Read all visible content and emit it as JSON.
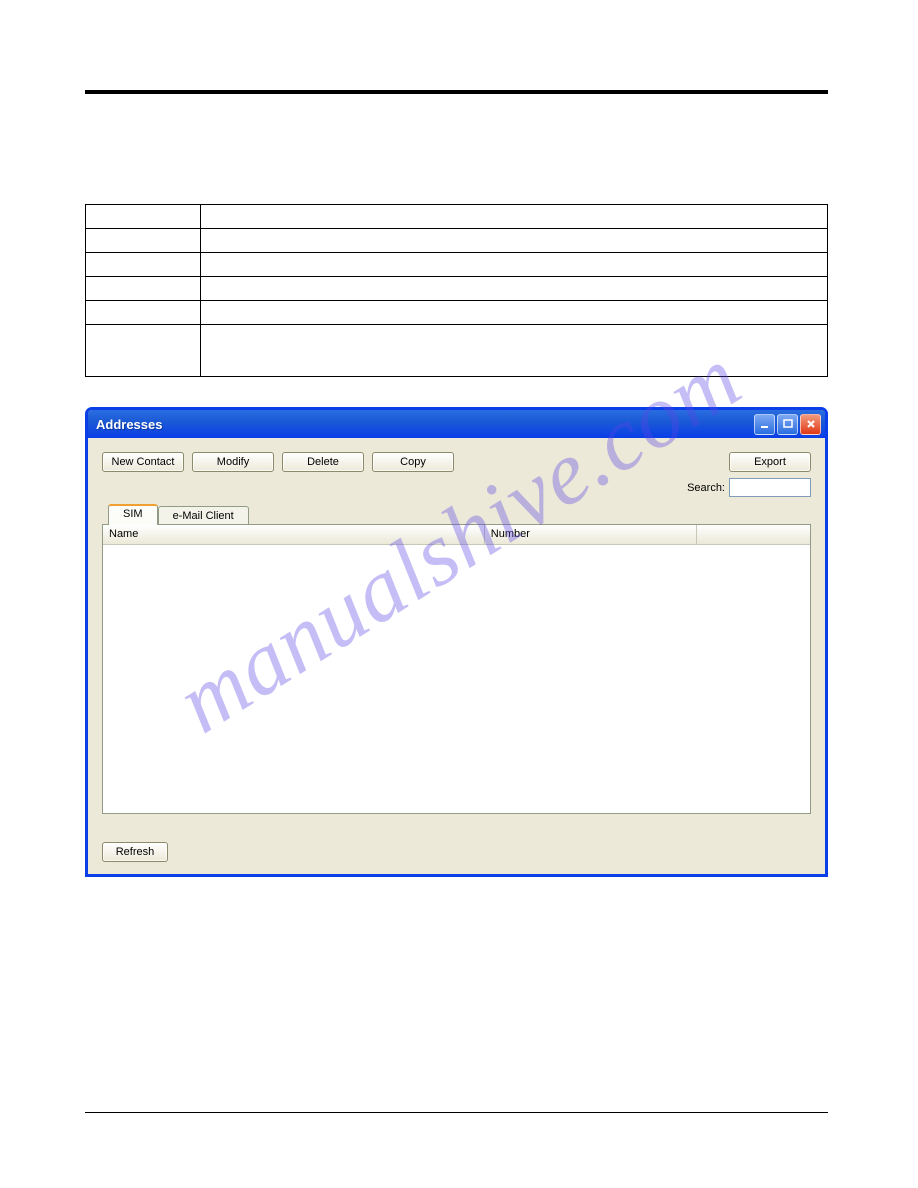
{
  "window": {
    "title": "Addresses"
  },
  "toolbar": {
    "newContact": "New Contact",
    "modify": "Modify",
    "delete": "Delete",
    "copy": "Copy",
    "export": "Export",
    "searchLabel": "Search:",
    "searchValue": ""
  },
  "tabs": {
    "sim": "SIM",
    "emailClient": "e-Mail Client"
  },
  "columns": {
    "name": "Name",
    "number": "Number"
  },
  "footer": {
    "refresh": "Refresh"
  },
  "watermark": "manualshive.com"
}
